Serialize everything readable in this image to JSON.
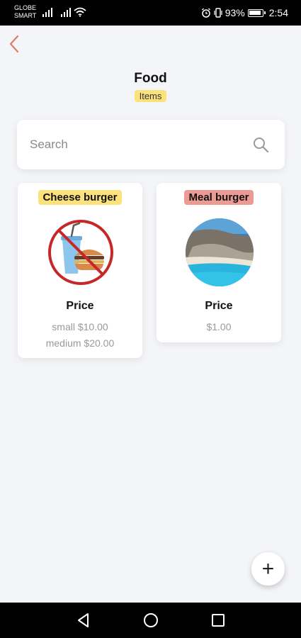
{
  "status_bar": {
    "carrier_line1": "GLOBE",
    "carrier_line2": "SMART",
    "battery": "93%",
    "time": "2:54"
  },
  "header": {
    "title": "Food",
    "subtitle": "Items"
  },
  "search": {
    "placeholder": "Search"
  },
  "items": [
    {
      "name": "Cheese burger",
      "tag_color": "#fbe27c",
      "image": "no-fast-food-icon",
      "price_label": "Price",
      "prices": [
        "small $10.00",
        "medium $20.00"
      ]
    },
    {
      "name": "Meal burger",
      "tag_color": "#ec9a94",
      "image": "beach-photo",
      "price_label": "Price",
      "prices": [
        "$1.00"
      ]
    }
  ],
  "fab": {
    "icon": "plus-icon",
    "label": "+"
  },
  "colors": {
    "accent_yellow": "#fbe27c",
    "accent_red": "#ec9a94",
    "back_arrow": "#e07a6a"
  }
}
